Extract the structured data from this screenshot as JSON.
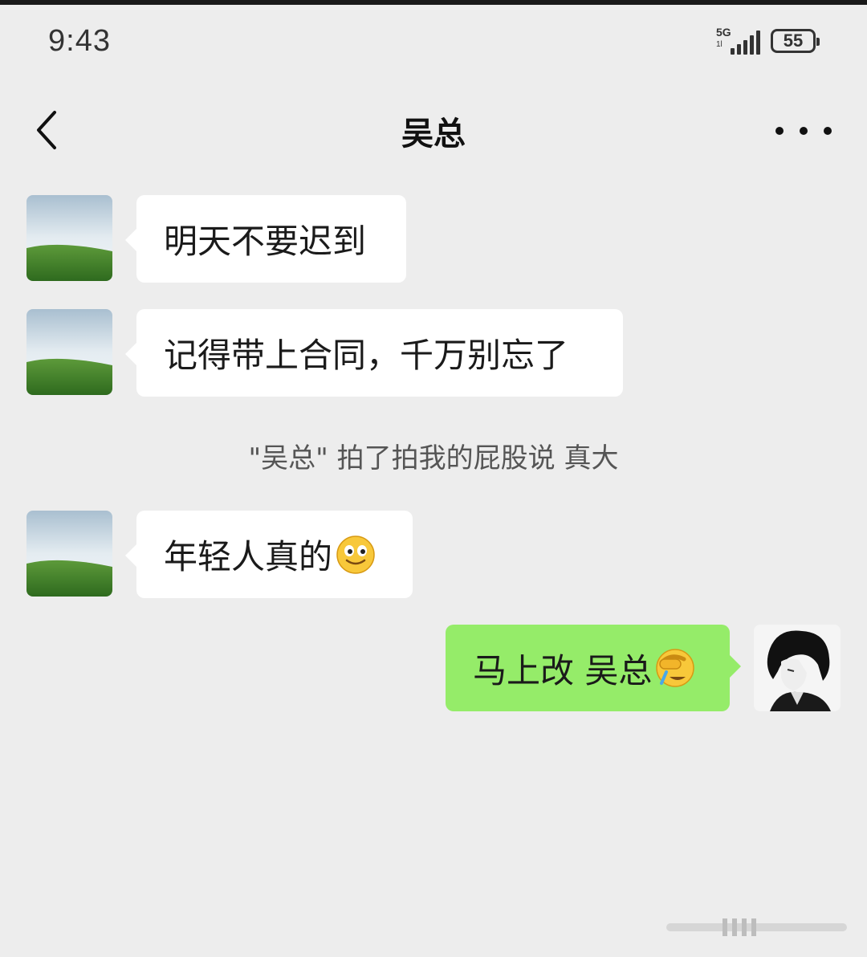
{
  "status_bar": {
    "time": "9:43",
    "network": "5G",
    "network_sub": "1l",
    "battery": "55"
  },
  "header": {
    "title": "吴总"
  },
  "messages": [
    {
      "side": "left",
      "text": "明天不要迟到"
    },
    {
      "side": "left",
      "text": "记得带上合同，千万别忘了"
    },
    {
      "side": "left",
      "text": "年轻人真的",
      "emoji": "smile-emoji"
    },
    {
      "side": "right",
      "text": "马上改 吴总",
      "emoji": "facepalm-cry-emoji"
    }
  ],
  "system_message": "\"吴总\" 拍了拍我的屁股说 真大",
  "colors": {
    "background": "#ededed",
    "bubble_left": "#ffffff",
    "bubble_right": "#95ec69"
  },
  "icons": [
    "back-icon",
    "more-icon",
    "signal-icon",
    "battery-icon"
  ]
}
